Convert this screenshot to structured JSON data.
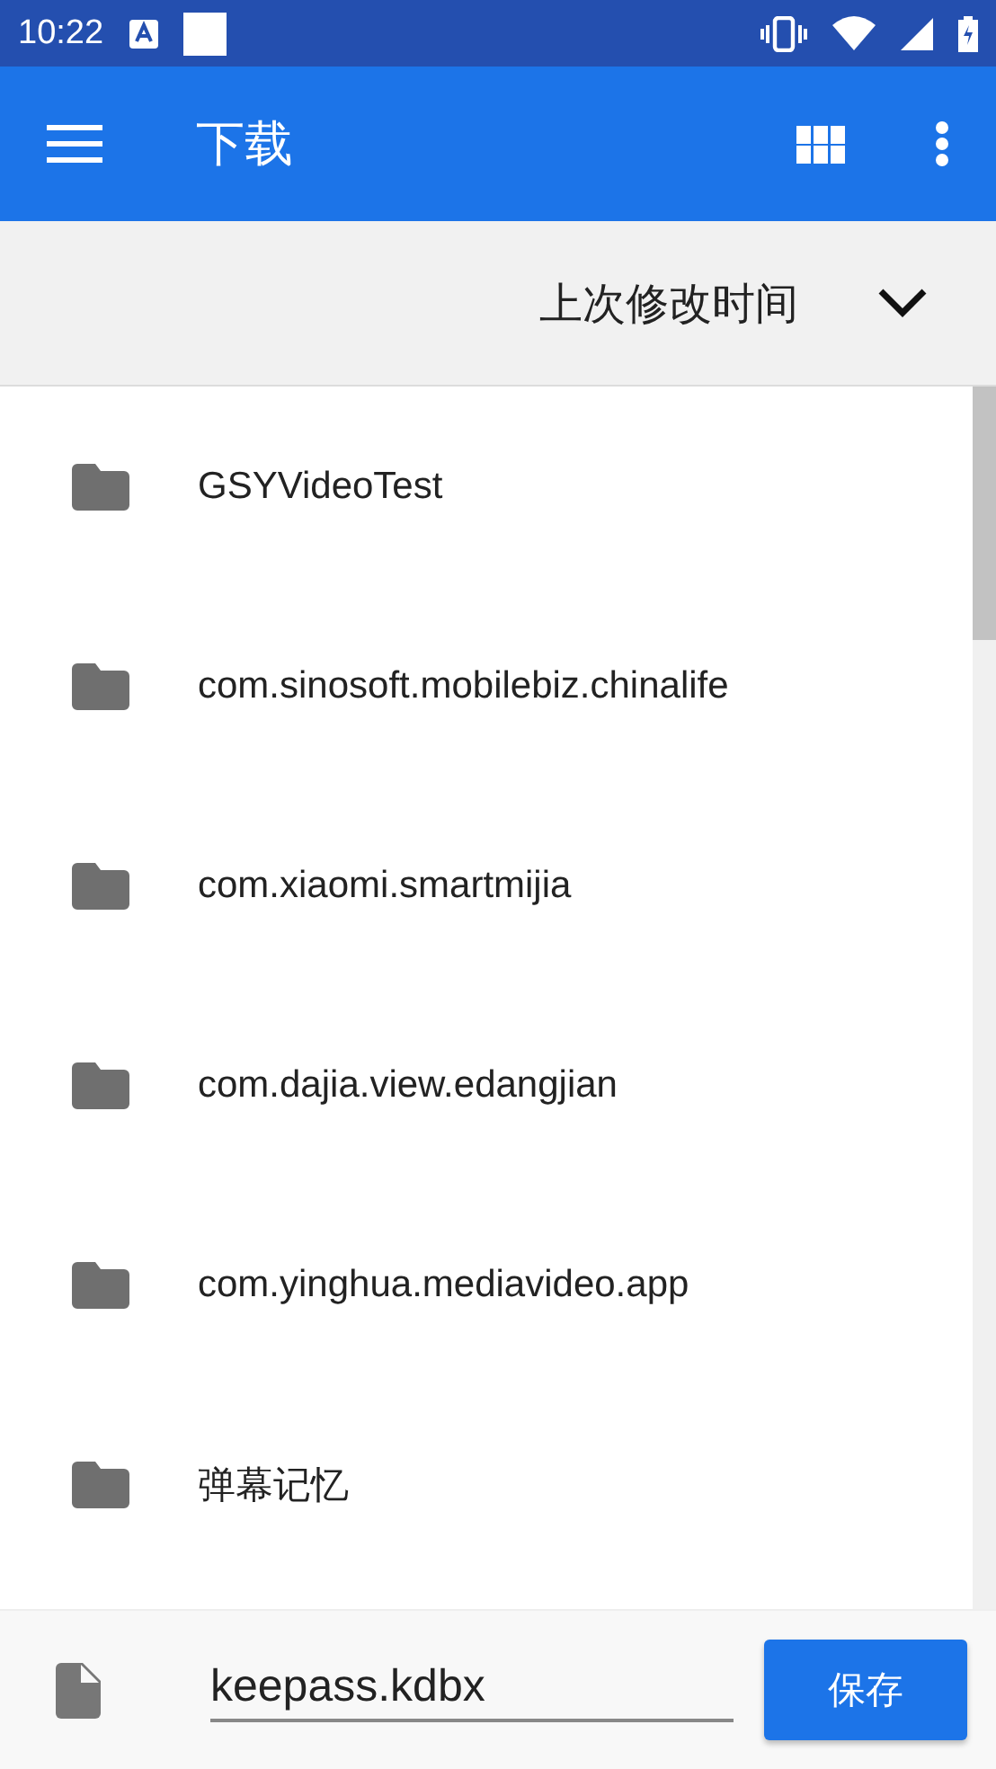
{
  "status_bar": {
    "time": "10:22"
  },
  "app_bar": {
    "title": "下载"
  },
  "sort_bar": {
    "label": "上次修改时间",
    "expanded": false
  },
  "folders": [
    {
      "name": "GSYVideoTest"
    },
    {
      "name": "com.sinosoft.mobilebiz.chinalife"
    },
    {
      "name": "com.xiaomi.smartmijia"
    },
    {
      "name": "com.dajia.view.edangjian"
    },
    {
      "name": "com.yinghua.mediavideo.app"
    },
    {
      "name": "弹幕记忆"
    }
  ],
  "save_bar": {
    "filename": "keepass.kdbx",
    "button": "保存"
  }
}
